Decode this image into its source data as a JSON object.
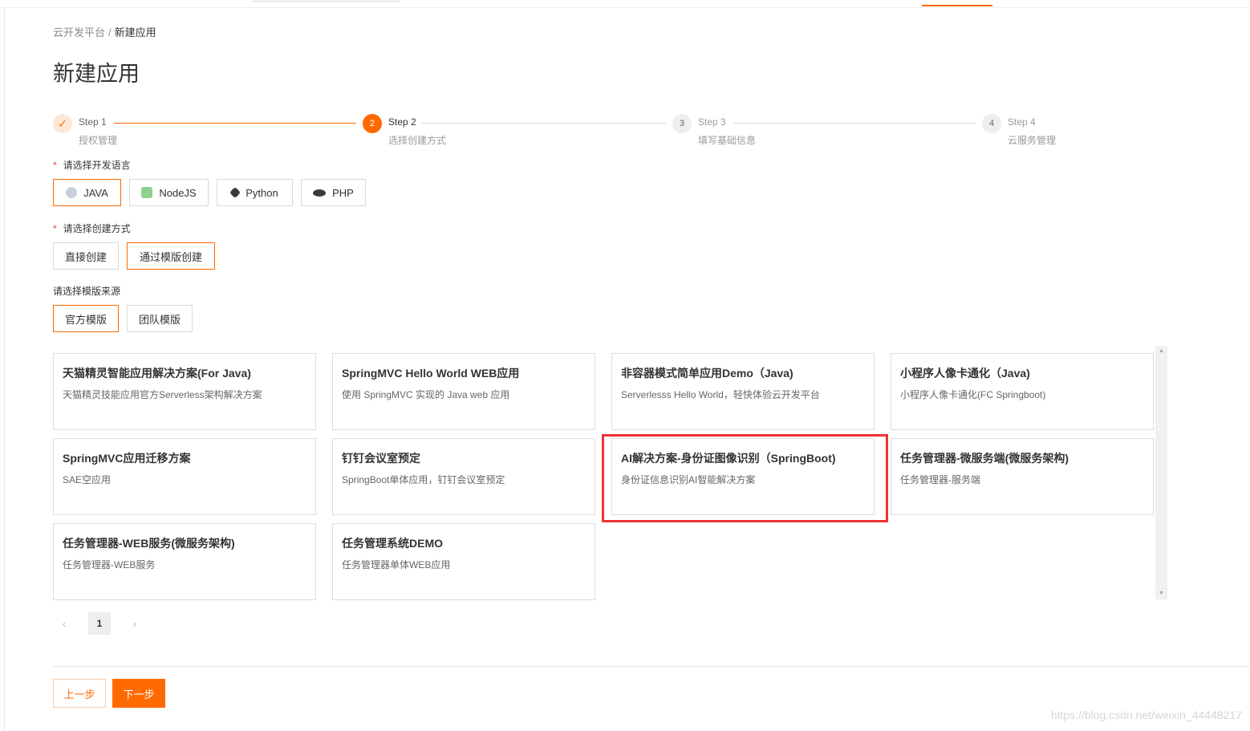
{
  "breadcrumb": {
    "root": "云开发平台",
    "separator": "/",
    "current": "新建应用"
  },
  "page_title": "新建应用",
  "steps": [
    {
      "title": "Step 1",
      "desc": "授权管理",
      "status": "done",
      "mark": "✓"
    },
    {
      "title": "Step 2",
      "desc": "选择创建方式",
      "status": "active",
      "mark": "2"
    },
    {
      "title": "Step 3",
      "desc": "填写基础信息",
      "status": "todo",
      "mark": "3"
    },
    {
      "title": "Step 4",
      "desc": "云服务管理",
      "status": "todo",
      "mark": "4"
    }
  ],
  "language": {
    "required_mark": "*",
    "label": "请选择开发语言",
    "options": [
      {
        "label": "JAVA",
        "icon": "java-icon",
        "selected": true
      },
      {
        "label": "NodeJS",
        "icon": "nodejs-icon",
        "selected": false
      },
      {
        "label": "Python",
        "icon": "python-icon",
        "selected": false
      },
      {
        "label": "PHP",
        "icon": "php-icon",
        "selected": false
      }
    ]
  },
  "create_method": {
    "required_mark": "*",
    "label": "请选择创建方式",
    "options": [
      {
        "label": "直接创建",
        "selected": false
      },
      {
        "label": "通过模版创建",
        "selected": true
      }
    ]
  },
  "template_source": {
    "label": "请选择模版来源",
    "options": [
      {
        "label": "官方模版",
        "selected": true
      },
      {
        "label": "团队模版",
        "selected": false
      }
    ]
  },
  "templates": [
    {
      "title": "天猫精灵智能应用解决方案(For Java)",
      "desc": "天猫精灵技能应用官方Serverless架构解决方案"
    },
    {
      "title": "SpringMVC Hello World WEB应用",
      "desc": "使用 SpringMVC 实现的 Java web 应用"
    },
    {
      "title": "非容器模式简单应用Demo（Java)",
      "desc": "Serverlesss Hello World，轻快体验云开发平台"
    },
    {
      "title": "小程序人像卡通化（Java)",
      "desc": "小程序人像卡通化(FC Springboot)"
    },
    {
      "title": "SpringMVC应用迁移方案",
      "desc": "SAE空应用"
    },
    {
      "title": "钉钉会议室预定",
      "desc": "SpringBoot单体应用，钉钉会议室预定"
    },
    {
      "title": "AI解决方案-身份证图像识别（SpringBoot)",
      "desc": "身份证信息识别AI智能解决方案"
    },
    {
      "title": "任务管理器-微服务端(微服务架构)",
      "desc": "任务管理器-服务端"
    },
    {
      "title": "任务管理器-WEB服务(微服务架构)",
      "desc": "任务管理器-WEB服务"
    },
    {
      "title": "任务管理系统DEMO",
      "desc": "任务管理器单体WEB应用"
    }
  ],
  "pagination": {
    "prev": "‹",
    "current_page": "1",
    "next": "›"
  },
  "footer": {
    "prev_label": "上一步",
    "next_label": "下一步"
  },
  "watermark": "https://blog.csdn.net/weixin_44448217",
  "colors": {
    "accent": "#ff6a00",
    "highlight": "#ef3333",
    "border": "#dcdcdc"
  }
}
